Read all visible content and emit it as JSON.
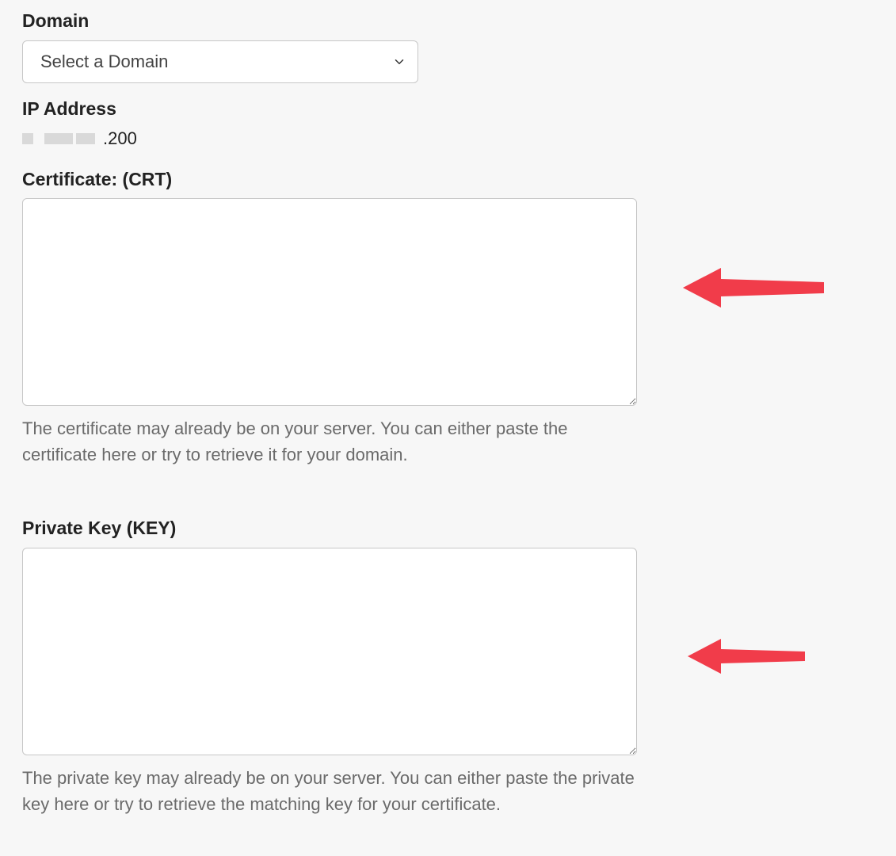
{
  "domain_section": {
    "label": "Domain",
    "select_placeholder": "Select a Domain"
  },
  "ip_section": {
    "label": "IP Address",
    "visible_suffix": ".200"
  },
  "certificate_section": {
    "label": "Certificate: (CRT)",
    "value": "",
    "help": "The certificate may already be on your server. You can either paste the certificate here or try to retrieve it for your domain."
  },
  "private_key_section": {
    "label": "Private Key (KEY)",
    "value": "",
    "help": "The private key may already be on your server. You can either paste the private key here or try to retrieve the matching key for your certificate."
  },
  "annotations": {
    "arrow_color": "#f13c4a"
  }
}
